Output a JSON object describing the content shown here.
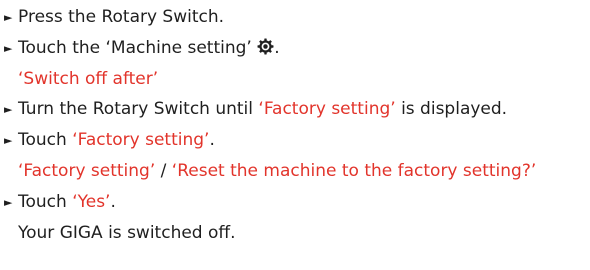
{
  "arrow_glyph": "►",
  "accent_color": "#e2342b",
  "steps": [
    {
      "text": "Press the Rotary Switch."
    },
    {
      "before": "Touch the ‘Machine setting’ ",
      "icon": "gear-icon",
      "after": "."
    },
    {
      "note": "‘Switch off after’"
    },
    {
      "before": "Turn the Rotary Switch until ",
      "highlight": "‘Factory setting’",
      "after": " is displayed."
    },
    {
      "before": "Touch ",
      "highlight": "‘Factory setting’",
      "after": "."
    },
    {
      "note_a": "‘Factory setting’",
      "separator": " / ",
      "note_b": "‘Reset the machine to the factory setting?’"
    },
    {
      "before": "Touch ",
      "highlight": "‘Yes’",
      "after": "."
    },
    {
      "plain": "Your GIGA is switched off."
    }
  ]
}
